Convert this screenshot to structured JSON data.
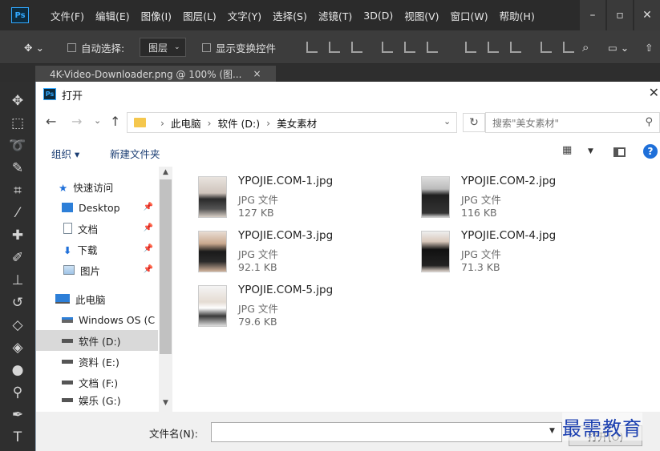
{
  "app": {
    "logo": "Ps"
  },
  "menu": [
    "文件(F)",
    "编辑(E)",
    "图像(I)",
    "图层(L)",
    "文字(Y)",
    "选择(S)",
    "滤镜(T)",
    "3D(D)",
    "视图(V)",
    "窗口(W)",
    "帮助(H)"
  ],
  "options": {
    "auto_select": "自动选择:",
    "layer": "图层",
    "show_transform": "显示变换控件"
  },
  "doc_tab": {
    "label": "4K-Video-Downloader.png @ 100% (图..."
  },
  "dialog": {
    "logo": "Ps",
    "title": "打开",
    "address": {
      "segments": [
        "此电脑",
        "软件 (D:)",
        "美女素材"
      ]
    },
    "search": {
      "placeholder": "搜索\"美女素材\""
    },
    "commands": {
      "organize": "组织 ▾",
      "new_folder": "新建文件夹"
    },
    "nav": [
      {
        "label": "快速访问",
        "icon": "star-icon"
      },
      {
        "label": "Desktop",
        "icon": "desktop-icon",
        "pinned": true
      },
      {
        "label": "文档",
        "icon": "document-icon",
        "pinned": true
      },
      {
        "label": "下载",
        "icon": "download-icon",
        "pinned": true
      },
      {
        "label": "图片",
        "icon": "pictures-icon",
        "pinned": true
      },
      {
        "label": "此电脑",
        "icon": "computer-icon"
      },
      {
        "label": "Windows OS (C",
        "icon": "drive-icon"
      },
      {
        "label": "软件 (D:)",
        "icon": "drive-icon",
        "selected": true
      },
      {
        "label": "资料 (E:)",
        "icon": "drive-icon"
      },
      {
        "label": "文档 (F:)",
        "icon": "drive-icon"
      },
      {
        "label": "娱乐 (G:)",
        "icon": "drive-icon"
      }
    ],
    "files": [
      {
        "name": "YPOJIE.COM-1.jpg",
        "type": "JPG 文件",
        "size": "127 KB"
      },
      {
        "name": "YPOJIE.COM-2.jpg",
        "type": "JPG 文件",
        "size": "116 KB"
      },
      {
        "name": "YPOJIE.COM-3.jpg",
        "type": "JPG 文件",
        "size": "92.1 KB"
      },
      {
        "name": "YPOJIE.COM-4.jpg",
        "type": "JPG 文件",
        "size": "71.3 KB"
      },
      {
        "name": "YPOJIE.COM-5.jpg",
        "type": "JPG 文件",
        "size": "79.6 KB"
      }
    ],
    "filename_label": "文件名(N):",
    "filename_value": "",
    "open_button": "打开(O)"
  },
  "watermark": "最需教育",
  "colors": {
    "ps_blue": "#31a8ff",
    "link_blue": "#1a3d73",
    "watermark": "#1b3fb0"
  }
}
